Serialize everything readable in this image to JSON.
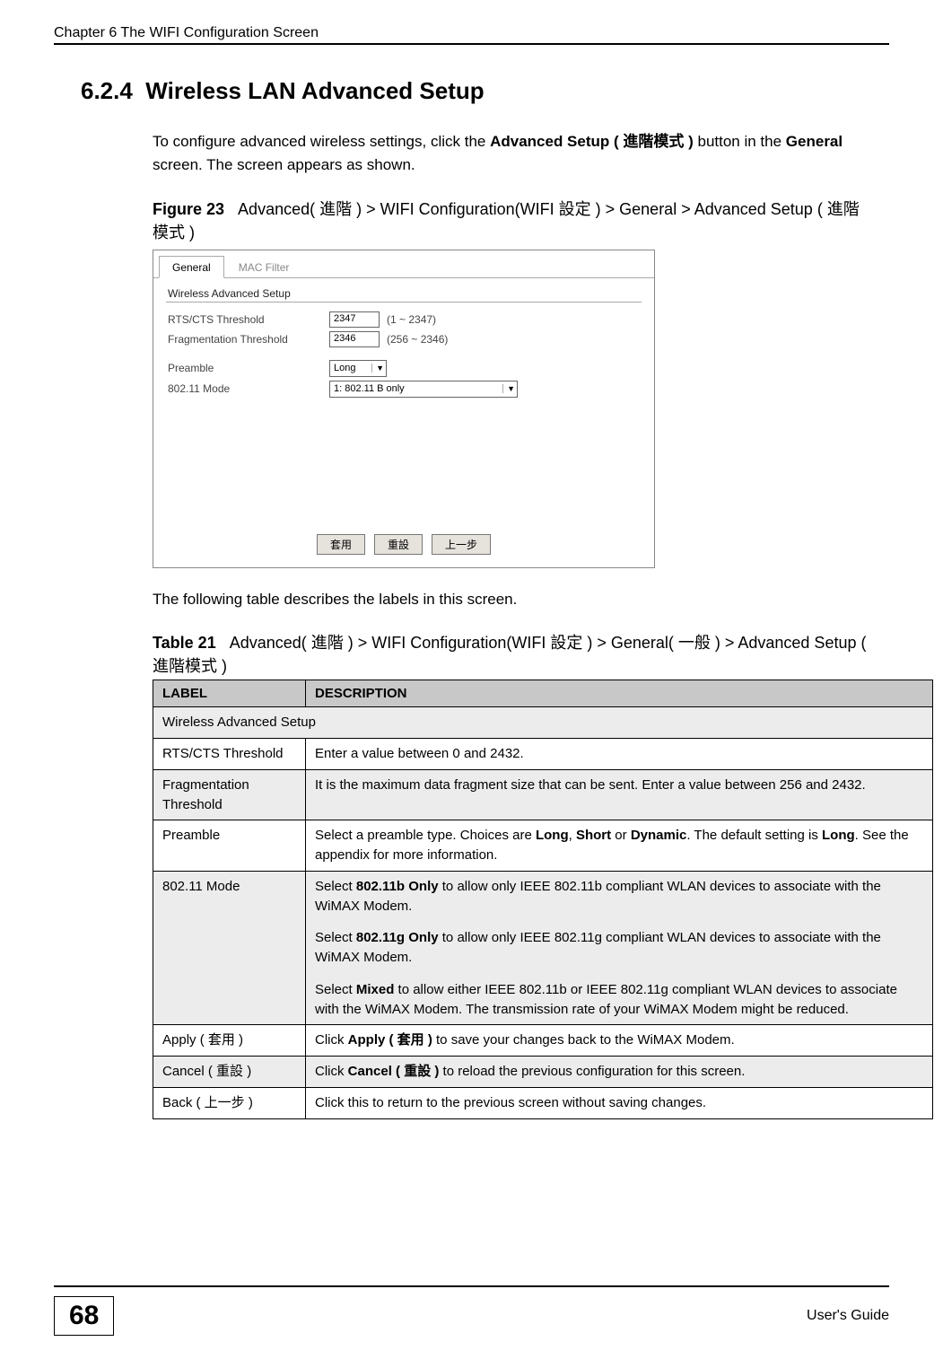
{
  "header": {
    "chapter": "Chapter 6 The WIFI Configuration Screen"
  },
  "section": {
    "number": "6.2.4",
    "title": "Wireless LAN Advanced Setup"
  },
  "intro_para": {
    "p1a": "To configure advanced wireless settings, click the ",
    "adv_btn": "Advanced Setup ( 進階模式 )",
    "p1b": " button in the ",
    "general": "General",
    "p1c": " screen. The screen appears as shown."
  },
  "figure": {
    "label": "Figure 23",
    "caption_a": "Advanced( 進階 ) > WIFI Configuration(WIFI 設定 ) > General > Advanced Setup ( 進階模式 )"
  },
  "screenshot": {
    "tab_general": "General",
    "tab_mac": "MAC Filter",
    "sub_title": "Wireless Advanced Setup",
    "rts_label": "RTS/CTS Threshold",
    "rts_value": "2347",
    "rts_range": "(1 ~ 2347)",
    "frag_label": "Fragmentation Threshold",
    "frag_value": "2346",
    "frag_range": "(256 ~ 2346)",
    "preamble_label": "Preamble",
    "preamble_value": "Long",
    "mode_label": "802.11 Mode",
    "mode_value": "1: 802.11 B only",
    "btn_apply": "套用",
    "btn_reset": "重設",
    "btn_back": "上一步"
  },
  "after_fig": "The following table describes the labels in this screen.",
  "table_caption": {
    "label": "Table 21",
    "caption_a": "Advanced( 進階 ) > WIFI Configuration(WIFI 設定 ) > General( 一般 ) > Advanced Setup ( 進階模式 )"
  },
  "table": {
    "head_label": "LABEL",
    "head_desc": "DESCRIPTION",
    "span_row": "Wireless Advanced Setup",
    "rows": [
      {
        "label": "RTS/CTS Threshold",
        "desc": "Enter a value between 0 and 2432.",
        "alt": false
      },
      {
        "label": "Fragmentation Threshold",
        "desc": "It is the maximum data fragment size that can be sent. Enter a value between 256 and 2432.",
        "alt": true
      },
      {
        "label": "Preamble",
        "desc_pre": "Select a preamble type. Choices are ",
        "b1": "Long",
        "sep1": ", ",
        "b2": "Short",
        "sep2": " or ",
        "b3": "Dynamic",
        "desc_post": ". The default setting is ",
        "b4": "Long",
        "desc_end": ". See the appendix for more information.",
        "alt": false,
        "type": "preamble"
      },
      {
        "label": "802.11 Mode",
        "type": "mode",
        "alt": true,
        "p1a": "Select ",
        "p1b": "802.11b Only",
        "p1c": " to allow only IEEE 802.11b compliant WLAN devices to associate with the WiMAX Modem.",
        "p2a": "Select ",
        "p2b": "802.11g Only",
        "p2c": " to allow only IEEE 802.11g compliant WLAN devices to associate with the WiMAX Modem.",
        "p3a": "Select ",
        "p3b": "Mixed",
        "p3c": " to allow either IEEE 802.11b or IEEE 802.11g compliant WLAN devices to associate with the WiMAX Modem. The transmission rate of your WiMAX Modem might be reduced."
      },
      {
        "label": "Apply ( 套用 )",
        "desc_pre": "Click ",
        "b1": "Apply ( 套用 )",
        "desc_post": " to save your changes back to the WiMAX Modem.",
        "alt": false,
        "type": "simplebold"
      },
      {
        "label": "Cancel ( 重設 )",
        "desc_pre": "Click ",
        "b1": "Cancel ( 重設 )",
        "desc_post": " to reload the previous configuration for this screen.",
        "alt": true,
        "type": "simplebold"
      },
      {
        "label": "Back ( 上一步 )",
        "desc": "Click this to return to the previous screen without saving changes.",
        "alt": false
      }
    ]
  },
  "footer": {
    "page": "68",
    "guide": "User's Guide"
  }
}
